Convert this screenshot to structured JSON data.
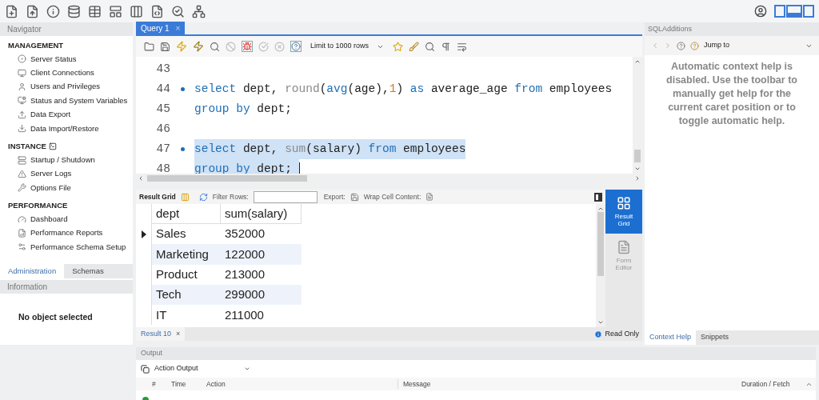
{
  "navigator": {
    "title": "Navigator",
    "sections": [
      {
        "title": "MANAGEMENT",
        "items": [
          "Server Status",
          "Client Connections",
          "Users and Privileges",
          "Status and System Variables",
          "Data Export",
          "Data Import/Restore"
        ]
      },
      {
        "title": "INSTANCE",
        "items": [
          "Startup / Shutdown",
          "Server Logs",
          "Options File"
        ]
      },
      {
        "title": "PERFORMANCE",
        "items": [
          "Dashboard",
          "Performance Reports",
          "Performance Schema Setup"
        ]
      }
    ],
    "tabs": [
      {
        "label": "Administration",
        "selected": true
      },
      {
        "label": "Schemas",
        "selected": false
      }
    ],
    "information": {
      "title": "Information",
      "text": "No object selected"
    }
  },
  "editor": {
    "tab": {
      "label": "Query 1",
      "close": "×"
    },
    "limit": "Limit to 1000 rows",
    "lines": [
      {
        "number": "43",
        "marker": false
      },
      {
        "number": "44",
        "marker": true,
        "selected": false,
        "tokens": [
          {
            "t": "select",
            "kind": "keyword"
          },
          {
            "t": " dept, ",
            "kind": "plain"
          },
          {
            "t": "round",
            "kind": "function"
          },
          {
            "t": "(",
            "kind": "plain"
          },
          {
            "t": "avg",
            "kind": "keyword"
          },
          {
            "t": "(age),",
            "kind": "plain"
          },
          {
            "t": "1",
            "kind": "number"
          },
          {
            "t": ") ",
            "kind": "plain"
          },
          {
            "t": "as",
            "kind": "keyword"
          },
          {
            "t": " average_age ",
            "kind": "plain"
          },
          {
            "t": "from",
            "kind": "keyword"
          },
          {
            "t": " employees",
            "kind": "plain"
          }
        ]
      },
      {
        "number": "45",
        "marker": false,
        "selected": false,
        "tokens": [
          {
            "t": "group by",
            "kind": "keyword"
          },
          {
            "t": " dept;",
            "kind": "plain"
          }
        ]
      },
      {
        "number": "46",
        "marker": false
      },
      {
        "number": "47",
        "marker": true,
        "selected": true,
        "tokens": [
          {
            "t": "select",
            "kind": "keyword"
          },
          {
            "t": " dept, ",
            "kind": "plain"
          },
          {
            "t": "sum",
            "kind": "function"
          },
          {
            "t": "(salary) ",
            "kind": "plain"
          },
          {
            "t": "from",
            "kind": "keyword"
          },
          {
            "t": " employees",
            "kind": "plain"
          }
        ]
      },
      {
        "number": "48",
        "marker": false,
        "selected": true,
        "tokens": [
          {
            "t": "group by",
            "kind": "keyword"
          },
          {
            "t": " dept; ",
            "kind": "plain"
          }
        ]
      }
    ]
  },
  "results": {
    "toolbar": {
      "result_grid": "Result Grid",
      "filter": "Filter Rows:",
      "export": "Export:",
      "wrap": "Wrap Cell Content:"
    },
    "columns": [
      "dept",
      "sum(salary)"
    ],
    "rows": [
      {
        "cells": [
          "Sales",
          "352000"
        ],
        "current": true
      },
      {
        "cells": [
          "Marketing",
          "122000"
        ],
        "current": false
      },
      {
        "cells": [
          "Product",
          "213000"
        ],
        "current": false
      },
      {
        "cells": [
          "Tech",
          "299000"
        ],
        "current": false
      },
      {
        "cells": [
          "IT",
          "211000"
        ],
        "current": false
      }
    ],
    "side_tabs": [
      {
        "label": "Result Grid",
        "selected": true
      },
      {
        "label": "Form Editor",
        "selected": false
      }
    ],
    "read_only": "Read Only",
    "result_tab": {
      "label": "Result 10",
      "close": "×"
    }
  },
  "sql_additions": {
    "title": "SQLAdditions",
    "jump": "Jump to",
    "help": "Automatic context help is disabled. Use the toolbar to manually get help for the current caret position or to toggle automatic help.",
    "tabs": [
      {
        "label": "Context Help",
        "selected": true
      },
      {
        "label": "Snippets",
        "selected": false
      }
    ]
  },
  "output": {
    "title": "Output",
    "mode": "Action Output",
    "columns": [
      "#",
      "Time",
      "Action",
      "Message",
      "Duration / Fetch"
    ]
  }
}
